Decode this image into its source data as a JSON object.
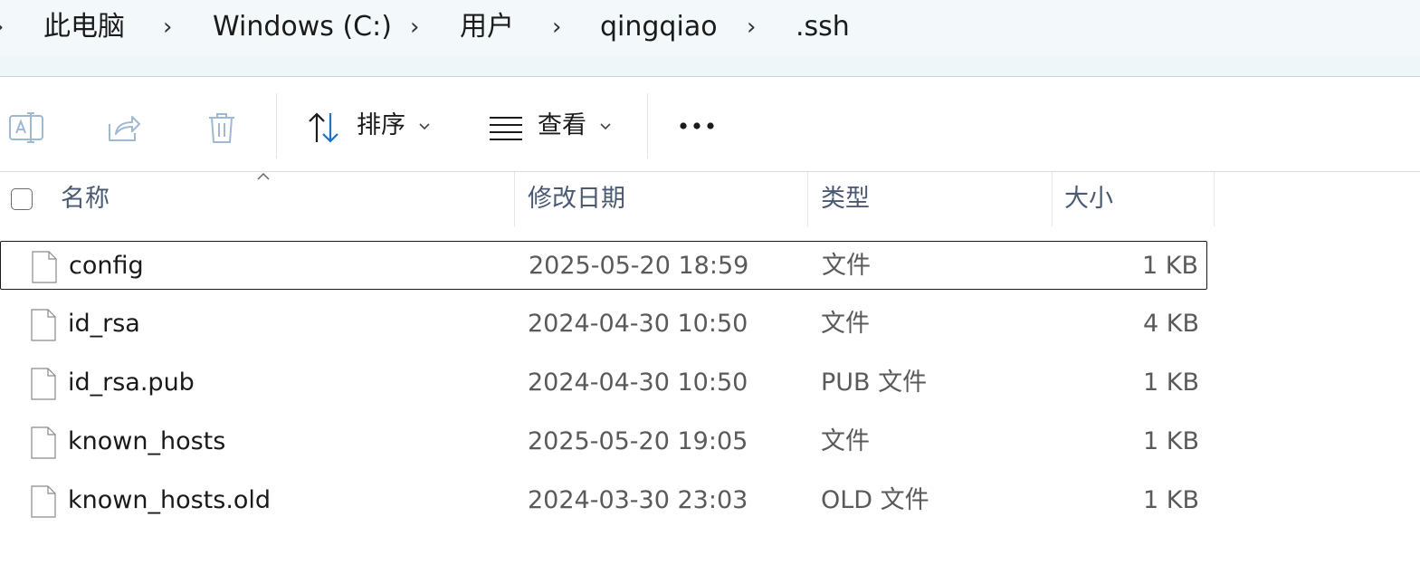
{
  "breadcrumb": {
    "items": [
      "此电脑",
      "Windows (C:)",
      "用户",
      "qingqiao",
      ".ssh"
    ],
    "separator": "›",
    "leading_separator": "›"
  },
  "toolbar": {
    "rename_icon": "rename-icon",
    "share_icon": "share-icon",
    "delete_icon": "delete-icon",
    "sort_label": "排序",
    "view_label": "查看",
    "more_label": "•••"
  },
  "columns": {
    "name": "名称",
    "modified": "修改日期",
    "type": "类型",
    "size": "大小"
  },
  "files": [
    {
      "name": "config",
      "modified": "2025-05-20 18:59",
      "type": "文件",
      "size": "1 KB",
      "selected": true
    },
    {
      "name": "id_rsa",
      "modified": "2024-04-30 10:50",
      "type": "文件",
      "size": "4 KB",
      "selected": false
    },
    {
      "name": "id_rsa.pub",
      "modified": "2024-04-30 10:50",
      "type": "PUB 文件",
      "size": "1 KB",
      "selected": false
    },
    {
      "name": "known_hosts",
      "modified": "2025-05-20 19:05",
      "type": "文件",
      "size": "1 KB",
      "selected": false
    },
    {
      "name": "known_hosts.old",
      "modified": "2024-03-30 23:03",
      "type": "OLD 文件",
      "size": "1 KB",
      "selected": false
    }
  ],
  "colors": {
    "accent": "#1a73c8",
    "disabled_icon": "#9fb9d3",
    "header_text": "#4a5a73"
  }
}
